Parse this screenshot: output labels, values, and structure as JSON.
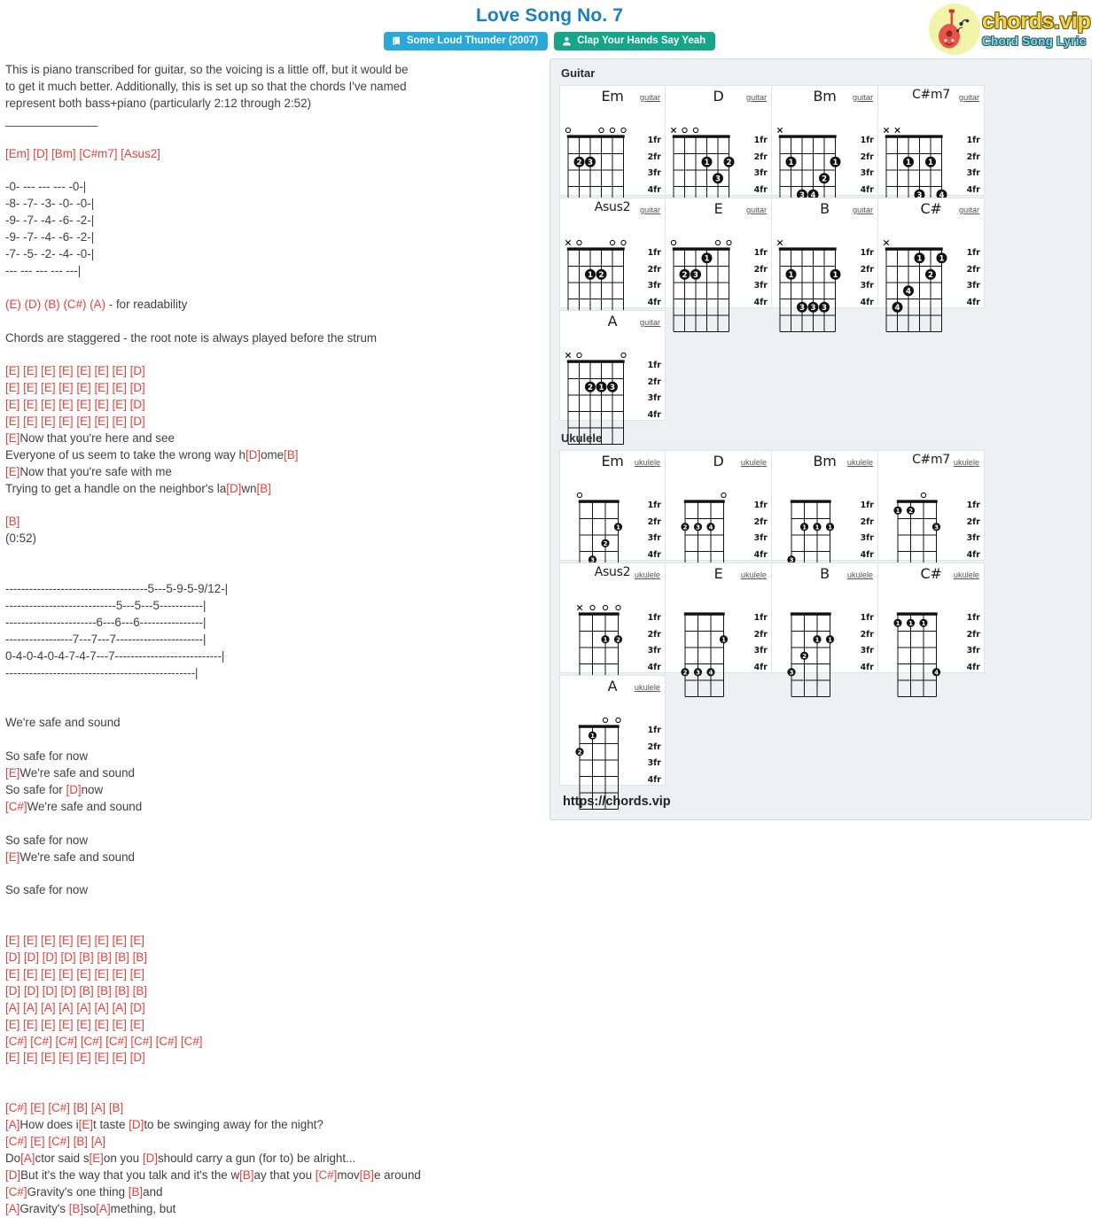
{
  "header": {
    "title": "Love Song No. 7",
    "album_badge": "Some Loud Thunder (2007)",
    "artist_badge": "Clap Your Hands Say Yeah",
    "album_icon": "book-icon",
    "artist_icon": "user-icon"
  },
  "logo": {
    "main": "chords.vip",
    "sub": "Chord Song Lyric",
    "icon": "guitar-icon"
  },
  "lyrics": {
    "segments": [
      {
        "t": "This is piano transcribed for guitar, so the voicing is a little off, but it would be\nto get it much better. Additionally, this is set up so that the chords I've named\nrepresent both bass+piano (particularly 2:12 through 2:52)\n______________\n\n",
        "c": false
      },
      {
        "t": "[Em] [D] [Bm] [C#m7] [Asus2]",
        "c": true
      },
      {
        "t": "\n\n-0- --- --- --- -0-|\n-8- -7- -3- -0- -0-|\n-9- -7- -4- -6- -2-|\n-9- -7- -4- -6- -2-|\n-7- -5- -2- -4- -0-|\n--- --- --- --- ---|\n\n",
        "c": false
      },
      {
        "t": "(E) (D) (B) (C#) (A)",
        "c": true
      },
      {
        "t": " - for readability\n\nChords are staggered - the root note is always played before the strum\n\n",
        "c": false
      },
      {
        "t": "[E] [E] [E] [E] [E] [E] [E] [D]\n[E] [E] [E] [E] [E] [E] [E] [D]\n[E] [E] [E] [E] [E] [E] [E] [D]\n[E] [E] [E] [E] [E] [E] [E] [D]\n[E]",
        "c": true
      },
      {
        "t": "Now that you're here and see\nEveryone of us seem to take the wrong way h",
        "c": false
      },
      {
        "t": "[D]",
        "c": true
      },
      {
        "t": "ome",
        "c": false
      },
      {
        "t": "[B]",
        "c": true
      },
      {
        "t": "\n",
        "c": false
      },
      {
        "t": "[E]",
        "c": true
      },
      {
        "t": "Now that you're safe with me\nTrying to get a handle on the neighbor's la",
        "c": false
      },
      {
        "t": "[D]",
        "c": true
      },
      {
        "t": "wn",
        "c": false
      },
      {
        "t": "[B]",
        "c": true
      },
      {
        "t": "\n\n",
        "c": false
      },
      {
        "t": "[B]",
        "c": true
      },
      {
        "t": "\n(0:52)\n\n\n------------------------------------5---5-9-5-9/12-|\n----------------------------5---5---5-----------|\n-----------------------6---6---6----------------|\n-----------------7---7---7----------------------|\n0-4-0-4-0-4-7-4-7---7---------------------------|\n------------------------------------------------|\n\n\nWe're safe and sound\n\nSo safe for now\n",
        "c": false
      },
      {
        "t": "[E]",
        "c": true
      },
      {
        "t": "We're safe and sound\nSo safe for ",
        "c": false
      },
      {
        "t": "[D]",
        "c": true
      },
      {
        "t": "now\n",
        "c": false
      },
      {
        "t": "[C#]",
        "c": true
      },
      {
        "t": "We're safe and sound\n\nSo safe for now\n",
        "c": false
      },
      {
        "t": "[E]",
        "c": true
      },
      {
        "t": "We're safe and sound\n\nSo safe for now\n\n\n",
        "c": false
      },
      {
        "t": "[E] [E] [E] [E] [E] [E] [E] [E]\n[D] [D] [D] [D] [B] [B] [B] [B]\n[E] [E] [E] [E] [E] [E] [E] [E]\n[D] [D] [D] [D] [B] [B] [B] [B]\n[A] [A] [A] [A] [A] [A] [A] [D]\n[E] [E] [E] [E] [E] [E] [E] [E]\n[C#] [C#] [C#] [C#] [C#] [C#] [C#] [C#]\n[E] [E] [E] [E] [E] [E] [E] [D]",
        "c": true
      },
      {
        "t": "\n\n\n",
        "c": false
      },
      {
        "t": "[C#] [E] [C#] [B] [A] [B]\n[A]",
        "c": true
      },
      {
        "t": "How does i",
        "c": false
      },
      {
        "t": "[E]",
        "c": true
      },
      {
        "t": "t taste ",
        "c": false
      },
      {
        "t": "[D]",
        "c": true
      },
      {
        "t": "to be swinging away for the night?\n",
        "c": false
      },
      {
        "t": "[C#] [E] [C#] [B] [A]",
        "c": true
      },
      {
        "t": "\nDo",
        "c": false
      },
      {
        "t": "[A]",
        "c": true
      },
      {
        "t": "ctor said s",
        "c": false
      },
      {
        "t": "[E]",
        "c": true
      },
      {
        "t": "on you ",
        "c": false
      },
      {
        "t": "[D]",
        "c": true
      },
      {
        "t": "should carry a gun (for to) be alright...\n",
        "c": false
      },
      {
        "t": "[D]",
        "c": true
      },
      {
        "t": "But it's the way that you talk and it's the w",
        "c": false
      },
      {
        "t": "[B]",
        "c": true
      },
      {
        "t": "ay that you ",
        "c": false
      },
      {
        "t": "[C#]",
        "c": true
      },
      {
        "t": "mov",
        "c": false
      },
      {
        "t": "[B]",
        "c": true
      },
      {
        "t": "e around\n",
        "c": false
      },
      {
        "t": "[C#]",
        "c": true
      },
      {
        "t": "Gravity's one thing ",
        "c": false
      },
      {
        "t": "[B]",
        "c": true
      },
      {
        "t": "and\n",
        "c": false
      },
      {
        "t": "[A]",
        "c": true
      },
      {
        "t": "Gravity's ",
        "c": false
      },
      {
        "t": "[B]",
        "c": true
      },
      {
        "t": "so",
        "c": false
      },
      {
        "t": "[A]",
        "c": true
      },
      {
        "t": "mething, but",
        "c": false
      }
    ]
  },
  "chord_panel": {
    "guitar_label": "Guitar",
    "ukulele_label": "Ukulele",
    "site_url": "https://chords.vip",
    "fret_labels": [
      "1fr",
      "2fr",
      "3fr",
      "4fr"
    ],
    "guitar": [
      {
        "name": "Em",
        "inst": "guitar",
        "strings": 6,
        "open": [
          "o",
          "",
          "",
          "o",
          "o",
          "o"
        ],
        "dots": [
          {
            "s": 1,
            "f": 2,
            "n": "2"
          },
          {
            "s": 2,
            "f": 2,
            "n": "3"
          }
        ]
      },
      {
        "name": "D",
        "inst": "guitar",
        "strings": 6,
        "open": [
          "x",
          "o",
          "o",
          "",
          "",
          ""
        ],
        "dots": [
          {
            "s": 3,
            "f": 2,
            "n": "1"
          },
          {
            "s": 5,
            "f": 2,
            "n": "2"
          },
          {
            "s": 4,
            "f": 3,
            "n": "3"
          }
        ]
      },
      {
        "name": "Bm",
        "inst": "guitar",
        "strings": 6,
        "open": [
          "x",
          "",
          "",
          "",
          "",
          ""
        ],
        "dots": [
          {
            "s": 1,
            "f": 2,
            "n": "1"
          },
          {
            "s": 5,
            "f": 2,
            "n": "1"
          },
          {
            "s": 4,
            "f": 3,
            "n": "2"
          },
          {
            "s": 2,
            "f": 4,
            "n": "3"
          },
          {
            "s": 3,
            "f": 4,
            "n": "4"
          }
        ]
      },
      {
        "name": "C#m7",
        "inst": "guitar",
        "strings": 6,
        "open": [
          "x",
          "x",
          "",
          "",
          "",
          ""
        ],
        "dots": [
          {
            "s": 2,
            "f": 2,
            "n": "1"
          },
          {
            "s": 4,
            "f": 2,
            "n": "1"
          },
          {
            "s": 3,
            "f": 4,
            "n": "3"
          },
          {
            "s": 5,
            "f": 4,
            "n": "4"
          }
        ]
      },
      {
        "name": "Asus2",
        "inst": "guitar",
        "strings": 6,
        "open": [
          "x",
          "o",
          "",
          "",
          "o",
          "o"
        ],
        "dots": [
          {
            "s": 2,
            "f": 2,
            "n": "1"
          },
          {
            "s": 3,
            "f": 2,
            "n": "2"
          }
        ]
      },
      {
        "name": "E",
        "inst": "guitar",
        "strings": 6,
        "open": [
          "o",
          "",
          "",
          "",
          "o",
          "o"
        ],
        "dots": [
          {
            "s": 3,
            "f": 1,
            "n": "1"
          },
          {
            "s": 1,
            "f": 2,
            "n": "2"
          },
          {
            "s": 2,
            "f": 2,
            "n": "3"
          }
        ]
      },
      {
        "name": "B",
        "inst": "guitar",
        "strings": 6,
        "open": [
          "x",
          "",
          "",
          "",
          "",
          ""
        ],
        "dots": [
          {
            "s": 1,
            "f": 2,
            "n": "1"
          },
          {
            "s": 5,
            "f": 2,
            "n": "1"
          },
          {
            "s": 2,
            "f": 4,
            "n": "3"
          },
          {
            "s": 3,
            "f": 4,
            "n": "3"
          },
          {
            "s": 4,
            "f": 4,
            "n": "3"
          }
        ]
      },
      {
        "name": "C#",
        "inst": "guitar",
        "strings": 6,
        "open": [
          "x",
          "",
          "",
          "",
          "",
          ""
        ],
        "dots": [
          {
            "s": 3,
            "f": 1,
            "n": "1"
          },
          {
            "s": 5,
            "f": 1,
            "n": "1"
          },
          {
            "s": 4,
            "f": 2,
            "n": "2"
          },
          {
            "s": 2,
            "f": 3,
            "n": "4"
          },
          {
            "s": 1,
            "f": 4,
            "n": "4"
          }
        ]
      },
      {
        "name": "A",
        "inst": "guitar",
        "strings": 6,
        "open": [
          "x",
          "o",
          "",
          "",
          "",
          "o"
        ],
        "dots": [
          {
            "s": 2,
            "f": 2,
            "n": "2"
          },
          {
            "s": 3,
            "f": 2,
            "n": "1"
          },
          {
            "s": 4,
            "f": 2,
            "n": "3"
          }
        ]
      }
    ],
    "ukulele": [
      {
        "name": "Em",
        "inst": "ukulele",
        "strings": 4,
        "open": [
          "o",
          "",
          "",
          ""
        ],
        "dots": [
          {
            "s": 3,
            "f": 2,
            "n": "1"
          },
          {
            "s": 2,
            "f": 3,
            "n": "2"
          },
          {
            "s": 1,
            "f": 4,
            "n": "3"
          }
        ]
      },
      {
        "name": "D",
        "inst": "ukulele",
        "strings": 4,
        "open": [
          "",
          "",
          "",
          "o"
        ],
        "dots": [
          {
            "s": 0,
            "f": 2,
            "n": "2"
          },
          {
            "s": 1,
            "f": 2,
            "n": "3"
          },
          {
            "s": 2,
            "f": 2,
            "n": "4"
          }
        ]
      },
      {
        "name": "Bm",
        "inst": "ukulele",
        "strings": 4,
        "open": [
          "",
          "",
          "",
          ""
        ],
        "dots": [
          {
            "s": 1,
            "f": 2,
            "n": "1"
          },
          {
            "s": 2,
            "f": 2,
            "n": "1"
          },
          {
            "s": 3,
            "f": 2,
            "n": "1"
          },
          {
            "s": 0,
            "f": 4,
            "n": "3"
          }
        ]
      },
      {
        "name": "C#m7",
        "inst": "ukulele",
        "strings": 4,
        "open": [
          "",
          "",
          "o",
          ""
        ],
        "dots": [
          {
            "s": 0,
            "f": 1,
            "n": "1"
          },
          {
            "s": 1,
            "f": 1,
            "n": "2"
          },
          {
            "s": 3,
            "f": 2,
            "n": "3"
          }
        ]
      },
      {
        "name": "Asus2",
        "inst": "ukulele",
        "strings": 4,
        "open": [
          "x",
          "o",
          "o",
          "o"
        ],
        "dots": [
          {
            "s": 2,
            "f": 2,
            "n": "1"
          },
          {
            "s": 3,
            "f": 2,
            "n": "2"
          }
        ]
      },
      {
        "name": "E",
        "inst": "ukulele",
        "strings": 4,
        "open": [
          "",
          "",
          "",
          ""
        ],
        "dots": [
          {
            "s": 3,
            "f": 2,
            "n": "1"
          },
          {
            "s": 0,
            "f": 4,
            "n": "2"
          },
          {
            "s": 1,
            "f": 4,
            "n": "3"
          },
          {
            "s": 2,
            "f": 4,
            "n": "4"
          }
        ]
      },
      {
        "name": "B",
        "inst": "ukulele",
        "strings": 4,
        "open": [
          "",
          "",
          "",
          ""
        ],
        "dots": [
          {
            "s": 2,
            "f": 2,
            "n": "1"
          },
          {
            "s": 3,
            "f": 2,
            "n": "1"
          },
          {
            "s": 1,
            "f": 3,
            "n": "2"
          },
          {
            "s": 0,
            "f": 4,
            "n": "3"
          }
        ]
      },
      {
        "name": "C#",
        "inst": "ukulele",
        "strings": 4,
        "open": [
          "",
          "",
          "",
          ""
        ],
        "dots": [
          {
            "s": 0,
            "f": 1,
            "n": "1"
          },
          {
            "s": 1,
            "f": 1,
            "n": "1"
          },
          {
            "s": 2,
            "f": 1,
            "n": "1"
          },
          {
            "s": 3,
            "f": 4,
            "n": "4"
          }
        ]
      },
      {
        "name": "A",
        "inst": "ukulele",
        "strings": 4,
        "open": [
          "",
          "",
          "o",
          "o"
        ],
        "dots": [
          {
            "s": 1,
            "f": 1,
            "n": "1"
          },
          {
            "s": 0,
            "f": 2,
            "n": "2"
          }
        ]
      }
    ]
  },
  "colors": {
    "title": "#1a7fc1",
    "chord_red": "#e8403a",
    "album_badge": "#2aa8d8",
    "artist_badge": "#17a589",
    "panel_bg": "#eef1f3"
  }
}
